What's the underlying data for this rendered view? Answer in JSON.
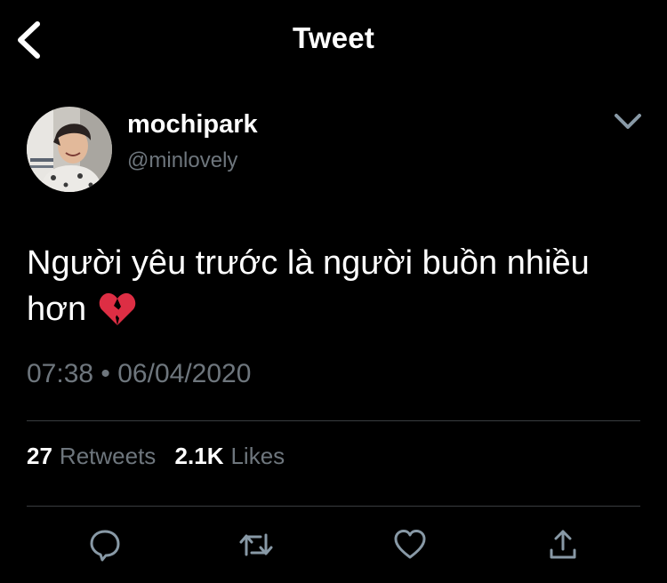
{
  "header": {
    "title": "Tweet",
    "back_icon": "chevron-left-icon"
  },
  "author": {
    "display_name": "mochipark",
    "handle": "@minlovely",
    "menu_icon": "chevron-down-icon"
  },
  "tweet": {
    "text": "Người yêu trước là người buồn nhiều hơn",
    "emoji": "broken-heart-icon",
    "timestamp": "07:38 • 06/04/2020"
  },
  "stats": {
    "retweets_count": "27",
    "retweets_label": "Retweets",
    "likes_count": "2.1K",
    "likes_label": "Likes"
  },
  "actions": [
    "reply-icon",
    "retweet-icon",
    "like-icon",
    "share-icon"
  ],
  "colors": {
    "background": "#000000",
    "text": "#ffffff",
    "secondary_text": "#6e767d",
    "divider": "#3a3d40",
    "icon_accent": "#8899a6"
  }
}
